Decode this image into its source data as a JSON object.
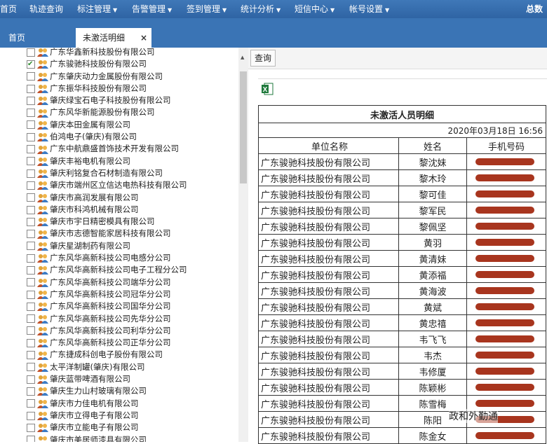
{
  "nav": {
    "items": [
      "首页",
      "轨迹查询",
      "标注管理",
      "告警管理",
      "签到管理",
      "统计分析",
      "短信中心",
      "帐号设置"
    ],
    "user": "总数"
  },
  "tabs": [
    {
      "label": "首页",
      "active": false
    },
    {
      "label": "未激活明细",
      "active": true,
      "close": "×"
    }
  ],
  "tree": [
    {
      "label": "广东华鑫新科技股份有限公司",
      "checked": false
    },
    {
      "label": "广东骏驰科技股份有限公司",
      "checked": true
    },
    {
      "label": "广东肇庆动力金属股份有限公司",
      "checked": false
    },
    {
      "label": "广东振华科技股份有限公司",
      "checked": false
    },
    {
      "label": "肇庆绿宝石电子科技股份有限公司",
      "checked": false
    },
    {
      "label": "广东风华新能源股份有限公司",
      "checked": false
    },
    {
      "label": "肇庆本田金属有限公司",
      "checked": false
    },
    {
      "label": "伯鸿电子(肇庆)有限公司",
      "checked": false
    },
    {
      "label": "广东中航鼎盛首饰技术开发有限公司",
      "checked": false
    },
    {
      "label": "肇庆丰裕电机有限公司",
      "checked": false
    },
    {
      "label": "肇庆利铭复合石材制造有限公司",
      "checked": false
    },
    {
      "label": "肇庆市端州区立信达电热科技有限公司",
      "checked": false
    },
    {
      "label": "肇庆市高润发展有限公司",
      "checked": false
    },
    {
      "label": "肇庆市科鸿机械有限公司",
      "checked": false
    },
    {
      "label": "肇庆市宇日精密模具有限公司",
      "checked": false
    },
    {
      "label": "肇庆市志德智能家居科技有限公司",
      "checked": false
    },
    {
      "label": "肇庆星湖制药有限公司",
      "checked": false
    },
    {
      "label": "广东风华高新科技公司电感分公司",
      "checked": false
    },
    {
      "label": "广东风华高新科技公司电子工程分公司",
      "checked": false
    },
    {
      "label": "广东风华高新科技公司端华分公司",
      "checked": false
    },
    {
      "label": "广东风华高新科技公司冠华分公司",
      "checked": false
    },
    {
      "label": "广东风华高新科技公司国华分公司",
      "checked": false
    },
    {
      "label": "广东风华高新科技公司先华分公司",
      "checked": false
    },
    {
      "label": "广东风华高新科技公司利华分公司",
      "checked": false
    },
    {
      "label": "广东风华高新科技公司正华分公司",
      "checked": false
    },
    {
      "label": "广东捷成科创电子股份有限公司",
      "checked": false
    },
    {
      "label": "太平洋制罐(肇庆)有限公司",
      "checked": false
    },
    {
      "label": "肇庆蓝带啤酒有限公司",
      "checked": false
    },
    {
      "label": "肇庆生力山村玻璃有限公司",
      "checked": false
    },
    {
      "label": "肇庆市力佳电机有限公司",
      "checked": false
    },
    {
      "label": "肇庆市立得电子有限公司",
      "checked": false
    },
    {
      "label": "肇庆市立能电子有限公司",
      "checked": false
    },
    {
      "label": "肇庆市美居师漆具有限公司",
      "checked": false
    }
  ],
  "query_button": "查询",
  "report": {
    "title": "未激活人员明细",
    "date": "2020年03月18日  16:56",
    "headers": [
      "单位名称",
      "姓名",
      "手机号码"
    ],
    "rows": [
      {
        "company": "广东骏驰科技股份有限公司",
        "name": "黎沈妹"
      },
      {
        "company": "广东骏驰科技股份有限公司",
        "name": "黎木玲"
      },
      {
        "company": "广东骏驰科技股份有限公司",
        "name": "黎可佳"
      },
      {
        "company": "广东骏驰科技股份有限公司",
        "name": "黎军民"
      },
      {
        "company": "广东骏驰科技股份有限公司",
        "name": "黎佩坚"
      },
      {
        "company": "广东骏驰科技股份有限公司",
        "name": "黄羽"
      },
      {
        "company": "广东骏驰科技股份有限公司",
        "name": "黄清妹"
      },
      {
        "company": "广东骏驰科技股份有限公司",
        "name": "黄添福"
      },
      {
        "company": "广东骏驰科技股份有限公司",
        "name": "黄海波"
      },
      {
        "company": "广东骏驰科技股份有限公司",
        "name": "黄斌"
      },
      {
        "company": "广东骏驰科技股份有限公司",
        "name": "黄忠禧"
      },
      {
        "company": "广东骏驰科技股份有限公司",
        "name": "韦飞飞"
      },
      {
        "company": "广东骏驰科技股份有限公司",
        "name": "韦杰"
      },
      {
        "company": "广东骏驰科技股份有限公司",
        "name": "韦修厦"
      },
      {
        "company": "广东骏驰科技股份有限公司",
        "name": "陈颖彬"
      },
      {
        "company": "广东骏驰科技股份有限公司",
        "name": "陈雪梅"
      },
      {
        "company": "广东骏驰科技股份有限公司",
        "name": "陈阳"
      },
      {
        "company": "广东骏驰科技股份有限公司",
        "name": "陈金女"
      }
    ]
  },
  "watermark": "政和外勤通",
  "colors": {
    "nav": "#3a74b5",
    "redaction": "#a8351e"
  }
}
